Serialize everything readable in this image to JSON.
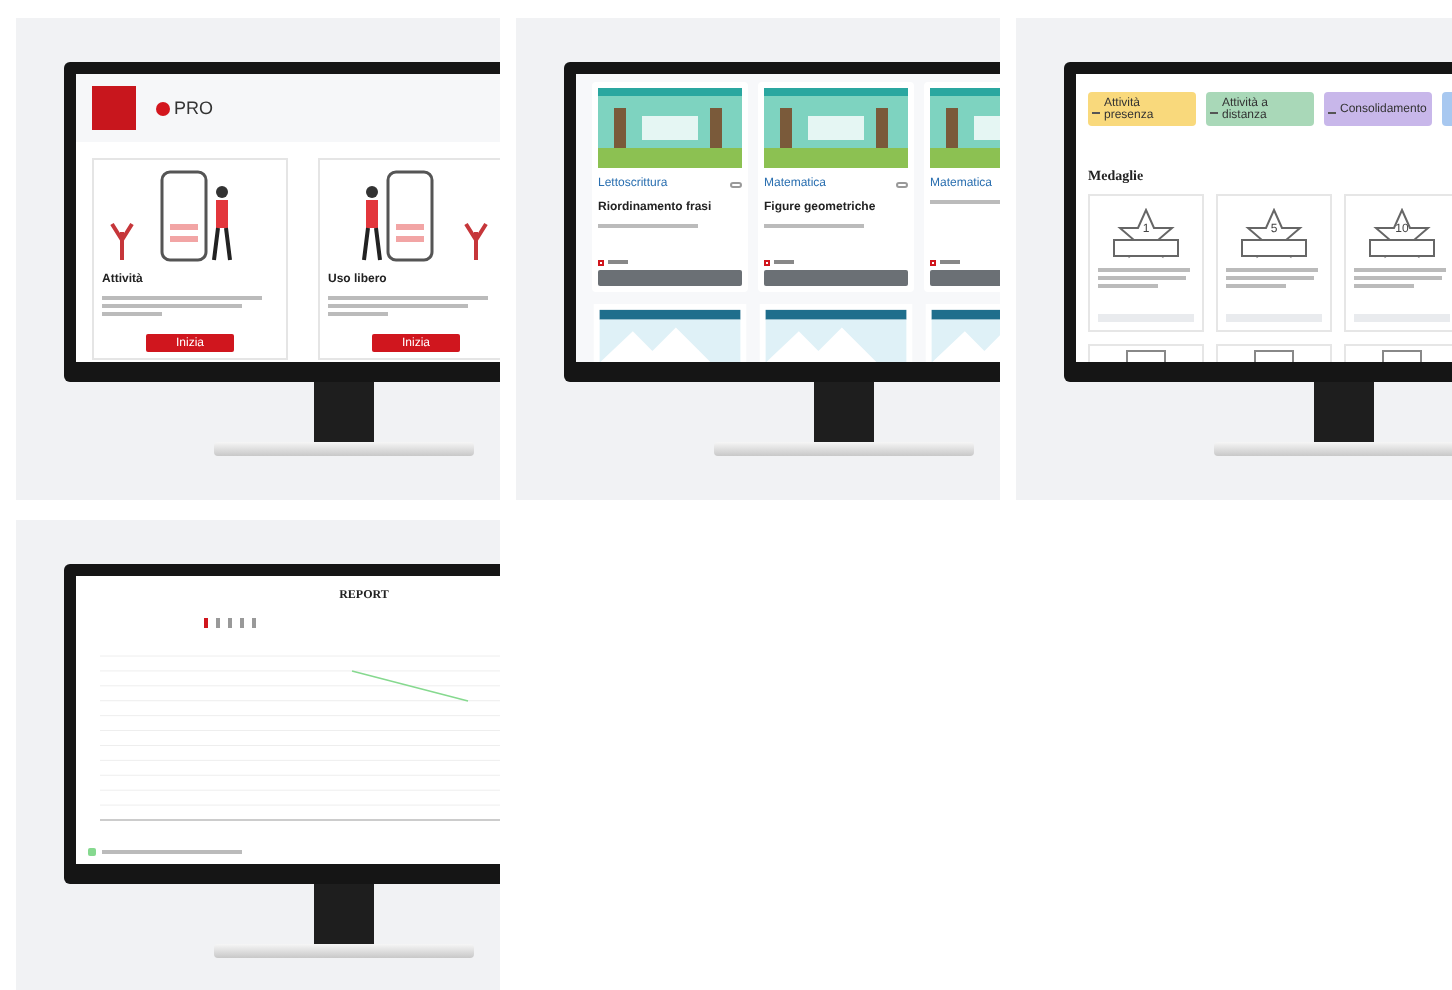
{
  "tiles": [
    {
      "kind": "home",
      "logo": "PRO",
      "cards": [
        {
          "title": "Attività",
          "button": "Inizia"
        },
        {
          "title": "Uso libero",
          "button": "Inizia"
        }
      ]
    },
    {
      "kind": "catalog",
      "cards": [
        {
          "subject": "Lettoscrittura",
          "title": "Riordinamento frasi"
        },
        {
          "subject": "Matematica",
          "title": "Figure geometriche"
        },
        {
          "subject": "Matematica"
        }
      ]
    },
    {
      "kind": "stats",
      "stats": [
        {
          "label": "Attività presenza",
          "color": "#f9d97c"
        },
        {
          "label": "Attività a distanza",
          "color": "#a9d8b8"
        },
        {
          "label": "Consolidamento",
          "color": "#c8b7ea"
        },
        {
          "color": "#a8c8f0"
        }
      ],
      "section": "Medaglie",
      "medals": [
        {
          "number": "1"
        },
        {
          "number": "5"
        },
        {
          "number": "10"
        }
      ]
    },
    {
      "kind": "report",
      "title": "REPORT"
    }
  ]
}
